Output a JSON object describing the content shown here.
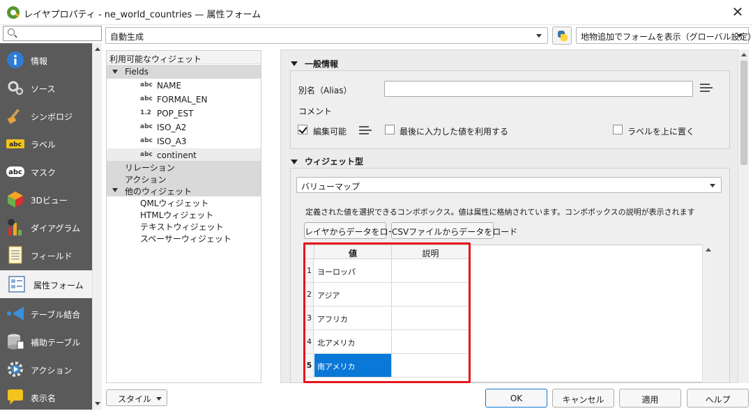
{
  "window": {
    "title": "レイヤプロパティ - ne_world_countries — 属性フォーム",
    "close": "✕"
  },
  "nav": {
    "search_placeholder": "",
    "items": [
      {
        "label": "情報",
        "icon": "info-icon"
      },
      {
        "label": "ソース",
        "icon": "source-icon"
      },
      {
        "label": "シンボロジ",
        "icon": "symbology-icon"
      },
      {
        "label": "ラベル",
        "icon": "labels-icon"
      },
      {
        "label": "マスク",
        "icon": "mask-icon"
      },
      {
        "label": "3Dビュー",
        "icon": "3d-view-icon"
      },
      {
        "label": "ダイアグラム",
        "icon": "diagrams-icon"
      },
      {
        "label": "フィールド",
        "icon": "fields-icon"
      },
      {
        "label": "属性フォーム",
        "icon": "attributes-form-icon"
      },
      {
        "label": "テーブル結合",
        "icon": "joins-icon"
      },
      {
        "label": "補助テーブル",
        "icon": "auxiliary-storage-icon"
      },
      {
        "label": "アクション",
        "icon": "actions-icon"
      },
      {
        "label": "表示名",
        "icon": "display-icon"
      }
    ],
    "active_index": 8
  },
  "toolbar": {
    "layout_combo": "自動生成",
    "form_mode_combo": "地物追加でフォームを表示（グローバル設定）"
  },
  "widget_tree": {
    "header": "利用可能なウィジェット",
    "fields_label": "Fields",
    "fields": [
      {
        "type": "abc",
        "name": "NAME"
      },
      {
        "type": "abc",
        "name": "FORMAL_EN"
      },
      {
        "type": "1.2",
        "name": "POP_EST"
      },
      {
        "type": "abc",
        "name": "ISO_A2"
      },
      {
        "type": "abc",
        "name": "ISO_A3"
      },
      {
        "type": "abc",
        "name": "continent"
      }
    ],
    "relations_label": "リレーション",
    "actions_label": "アクション",
    "other_label": "他のウィジェット",
    "other_widgets": [
      "QMLウィジェット",
      "HTMLウィジェット",
      "テキストウィジェット",
      "スペーサーウィジェット"
    ]
  },
  "general": {
    "section_title": "一般情報",
    "alias_label": "別名（Alias）",
    "alias_value": "",
    "comment_label": "コメント",
    "editable_label": "編集可能",
    "editable_checked": true,
    "reuse_last_label": "最後に入力した値を利用する",
    "reuse_last_checked": false,
    "label_on_top_label": "ラベルを上に置く",
    "label_on_top_checked": false
  },
  "widget_type": {
    "section_title": "ウィジェット型",
    "selected": "バリューマップ",
    "description": "定義された値を選択できるコンボボックス。値は属性に格納されています。コンボボックスの説明が表示されます",
    "load_layer_button": "レイヤからデータをロード",
    "load_csv_button": "CSVファイルからデータをロード",
    "table": {
      "columns": [
        "値",
        "説明"
      ],
      "rows": [
        {
          "num": "1",
          "value": "ヨーロッパ",
          "description": ""
        },
        {
          "num": "2",
          "value": "アジア",
          "description": ""
        },
        {
          "num": "3",
          "value": "アフリカ",
          "description": ""
        },
        {
          "num": "4",
          "value": "北アメリカ",
          "description": ""
        },
        {
          "num": "5",
          "value": "南アメリカ",
          "description": ""
        }
      ],
      "selected_row": 5,
      "highlight_color": "#e8141c"
    }
  },
  "bottom": {
    "style_button": "スタイル",
    "ok": "OK",
    "cancel": "キャンセル",
    "apply": "適用",
    "help": "ヘルプ"
  },
  "colors": {
    "nav_bg": "#5a5a5a",
    "selection": "#0a78d7",
    "qgis_green": "#589632"
  }
}
